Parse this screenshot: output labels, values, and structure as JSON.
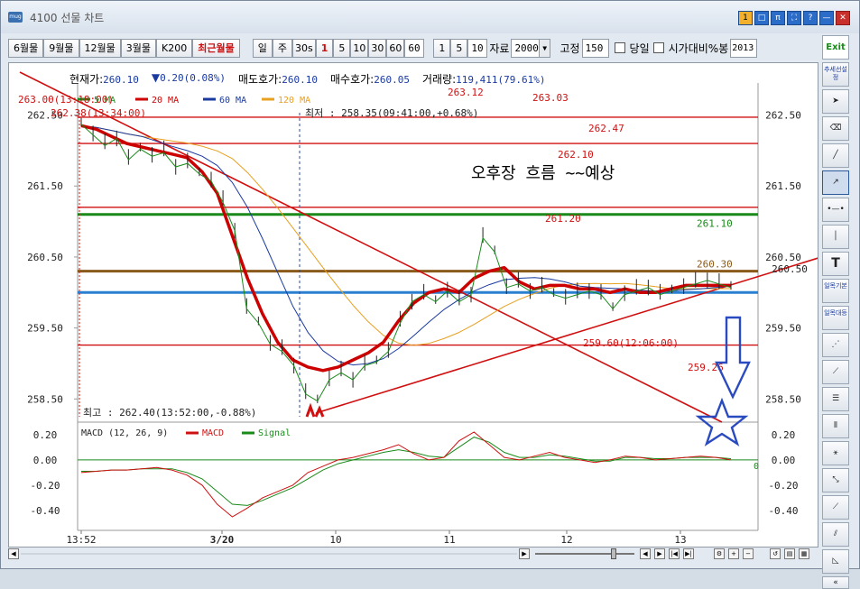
{
  "window": {
    "title": "4100 선물 차트",
    "app_icon": "mug"
  },
  "title_buttons": [
    "1",
    "□",
    "π",
    "⛶",
    "?",
    "—",
    "✕"
  ],
  "toolbar": {
    "month_tabs": [
      "6월물",
      "9월물",
      "12월물",
      "3월물",
      "K200"
    ],
    "recent_tab": "최근월물",
    "period_tabs": [
      "일",
      "주",
      "30s"
    ],
    "minute_tabs": [
      "1",
      "5",
      "10",
      "30",
      "60"
    ],
    "minute_value": "60",
    "tick_tabs": [
      "1",
      "5"
    ],
    "tick_value": "10",
    "data_label": "자료",
    "data_value": "2000",
    "fixed_label": "고정",
    "fixed_value": "150",
    "today_label": "당일",
    "timecmp_label": "시가대비%봉",
    "year_value": "2013"
  },
  "info": {
    "cur_label": "현재가:",
    "cur_value": "260.10",
    "chg_value": "0.20(0.08%)",
    "ask_label": "매도호가:",
    "ask_value": "260.10",
    "bid_label": "매수호가:",
    "bid_value": "260.05",
    "vol_label": "거래량:",
    "vol_value": "119,411(79.61%)"
  },
  "chart_data": {
    "type": "line",
    "title": "",
    "ylim": [
      258.25,
      262.85
    ],
    "y_ticks": [
      "262.50",
      "261.50",
      "260.50",
      "259.50",
      "258.50"
    ],
    "x_ticks": [
      "13:52",
      "3/20",
      "10",
      "11",
      "12",
      "13"
    ],
    "legend": [
      "5 MA",
      "20 MA",
      "60 MA",
      "120 MA"
    ],
    "legend_colors": [
      "#1a8a1a",
      "#cc0000",
      "#1a3aa0",
      "#e8a020"
    ],
    "price_series": [
      262.4,
      262.25,
      262.1,
      262.2,
      261.9,
      262.05,
      261.95,
      262.0,
      261.8,
      261.85,
      261.7,
      261.6,
      261.3,
      260.9,
      259.8,
      259.6,
      259.3,
      259.2,
      259.0,
      258.6,
      258.5,
      258.8,
      258.9,
      258.8,
      259.0,
      259.05,
      259.2,
      259.6,
      259.9,
      260.0,
      259.9,
      260.05,
      259.9,
      260.0,
      260.8,
      260.6,
      260.1,
      260.15,
      260.05,
      260.1,
      260.0,
      259.95,
      260.0,
      260.05,
      260.0,
      259.8,
      260.0,
      260.05,
      260.1,
      260.0,
      260.05,
      260.1,
      260.15,
      260.2,
      260.15,
      260.1
    ],
    "ma20_series": [
      262.35,
      262.3,
      262.2,
      262.1,
      262.05,
      262.0,
      261.95,
      261.9,
      261.7,
      261.4,
      260.8,
      260.2,
      259.7,
      259.3,
      259.05,
      258.95,
      258.9,
      258.95,
      259.05,
      259.15,
      259.3,
      259.6,
      259.85,
      260.0,
      260.05,
      260.0,
      260.2,
      260.3,
      260.35,
      260.15,
      260.05,
      260.1,
      260.1,
      260.05,
      260.05,
      260.0,
      260.05,
      260.0,
      260.0,
      260.05,
      260.1,
      260.1,
      260.1,
      260.1
    ],
    "hlines": [
      {
        "value": "262.47",
        "color": "#d01010"
      },
      {
        "value": "262.10",
        "color": "#d01010"
      },
      {
        "value": "261.20",
        "color": "#d01010"
      },
      {
        "value": "261.10",
        "color": "#1a8a1a"
      },
      {
        "value": "260.30",
        "color": "#8a5a1a"
      },
      {
        "value": "260.00",
        "color": "#2a80d0"
      },
      {
        "value": "259.26",
        "color": "#d01010"
      }
    ],
    "annotations": {
      "low": "최저 : 258.35(09:41:00,+0.68%)",
      "high": "최고 : 262.40(13:52:00,-0.88%)",
      "left_a": "263.00(13:18:00)",
      "left_b": "262.38(13:34:00)",
      "top_a": "263.12",
      "top_b": "263.03",
      "lvl_262_47": "262.47",
      "lvl_262_10": "262.10",
      "lvl_261_20": "261.20",
      "lvl_261_10": "261.10",
      "lvl_260_30": "260.30",
      "lvl_259_60": "259.60(12:06:00)",
      "lvl_259_26": "259.26",
      "right_y": "260.50",
      "zero": "0",
      "note": "오후장 흐름 ~~예상"
    },
    "macd": {
      "title": "MACD (12, 26, 9)",
      "legend": [
        "MACD",
        "Signal"
      ],
      "y_ticks": [
        "0.20",
        "0.00",
        "-0.20",
        "-0.40"
      ],
      "ylim": [
        -0.5,
        0.27
      ],
      "macd_series": [
        -0.1,
        -0.09,
        -0.08,
        -0.08,
        -0.07,
        -0.06,
        -0.08,
        -0.12,
        -0.2,
        -0.35,
        -0.45,
        -0.38,
        -0.3,
        -0.25,
        -0.2,
        -0.1,
        -0.05,
        0.0,
        0.02,
        0.05,
        0.08,
        0.12,
        0.05,
        0.0,
        0.02,
        0.15,
        0.22,
        0.12,
        0.02,
        0.0,
        0.03,
        0.06,
        0.02,
        0.0,
        -0.02,
        0.0,
        0.03,
        0.02,
        0.0,
        0.01,
        0.02,
        0.03,
        0.02,
        0.0
      ],
      "signal_series": [
        -0.09,
        -0.09,
        -0.08,
        -0.08,
        -0.07,
        -0.07,
        -0.07,
        -0.1,
        -0.15,
        -0.25,
        -0.35,
        -0.36,
        -0.32,
        -0.27,
        -0.22,
        -0.15,
        -0.08,
        -0.03,
        0.0,
        0.03,
        0.06,
        0.08,
        0.06,
        0.03,
        0.02,
        0.1,
        0.18,
        0.14,
        0.06,
        0.02,
        0.02,
        0.04,
        0.03,
        0.01,
        -0.01,
        -0.01,
        0.02,
        0.02,
        0.01,
        0.01,
        0.02,
        0.02,
        0.02,
        0.01
      ]
    }
  },
  "right_tools": [
    "Exit",
    "추세선설정",
    "pointer-icon",
    "eraser-icon",
    "line-icon",
    "arrow-line-icon",
    "hline-icon",
    "vline-icon",
    "T",
    "일목기본",
    "일목대등",
    "fan-icon",
    "fib-fan-icon",
    "fib-retrace-icon",
    "cycle-icon",
    "gann-icon",
    "gann-fan-icon",
    "speed-icon",
    "parallel-icon",
    "triangle-icon",
    "«"
  ]
}
